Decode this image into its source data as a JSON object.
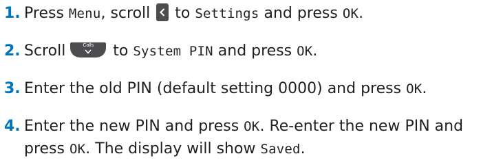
{
  "steps": [
    {
      "number": "1.",
      "parts": {
        "a": "Press ",
        "b": "Menu",
        "c": ", scroll ",
        "d": " to ",
        "e": "Settings",
        "f": " and press ",
        "g": "OK",
        "h": "."
      },
      "icon": "left-arrow-key-icon"
    },
    {
      "number": "2.",
      "parts": {
        "a": "Scroll ",
        "b": " to ",
        "c": "System PIN",
        "d": " and press ",
        "e": "OK",
        "f": "."
      },
      "icon": "calls-down-key-icon",
      "icon_label": "Calls"
    },
    {
      "number": "3.",
      "parts": {
        "a": "Enter the old PIN (default setting 0000) and press ",
        "b": "OK",
        "c": "."
      }
    },
    {
      "number": "4.",
      "parts": {
        "a": "Enter the new PIN and press ",
        "b": "OK",
        "c": ". Re-enter the new PIN and",
        "d": "press ",
        "e": "OK",
        "f": ". The display will show ",
        "g": "Saved",
        "h": "."
      }
    }
  ],
  "colors": {
    "step_number": "#0075bf",
    "text": "#231f20",
    "key_background": "#4d4d4f",
    "key_foreground": "#ffffff"
  }
}
